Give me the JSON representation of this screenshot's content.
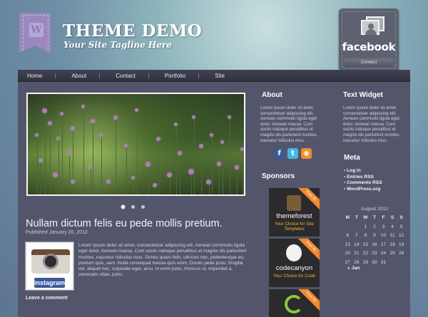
{
  "site": {
    "title": "THEME DEMO",
    "tagline": "Your Site Tagline Here",
    "logo_letter": "W"
  },
  "facebook": {
    "brand": "facebook",
    "connect_label": "Connect"
  },
  "nav": {
    "items": [
      "Home",
      "About",
      "Contact",
      "Portfolio",
      "Site"
    ]
  },
  "slider": {
    "dots": 3,
    "active_dot": 0
  },
  "post": {
    "title": "Nullam dictum felis eu pede mollis pretium.",
    "date": "Published January 20, 2012",
    "thumb_label": "instagram",
    "excerpt": "Lorem ipsum dolor sit amet, consectetuer adipiscing elit. Aenean commodo ligula eget dolor. Aenean massa. Cum sociis natoque penatibus et magnis dis parturient montes, nascetur ridiculus mus. Donec quam felis, ultricies nec, pellentesque eu, pretium quis, sem. Nulla consequat massa quis enim. Donec pede justo, fringilla vel, aliquet nec, vulputate eget, arcu. In enim justo, rhoncus ut, imperdiet a, venenatis vitae, justo.",
    "leave_comment": "Leave a comment"
  },
  "about": {
    "title": "About",
    "text": "Lorem ipsum dolor sit amet, consectetuer adipiscing elit. Aenean commodo ligula eget dolor. Aenean massa. Cum sociis natoque penatibus et magnis dis parturient montes, nascetur ridiculus mus."
  },
  "text_widget": {
    "title": "Text Widget",
    "text": "Lorem ipsum dolor sit amet, consectetuer adipiscing elit. Aenean commodo ligula eget dolor. Aenean massa. Cum sociis natoque penatibus et magnis dis parturient montes, nascetur ridiculus mus."
  },
  "social_icons": [
    "facebook-icon",
    "twitter-icon",
    "rss-icon"
  ],
  "sponsors": {
    "title": "Sponsors",
    "items": [
      {
        "corner": "From $1",
        "brand": "themeforest",
        "sub": "Your Choice for Site Templates"
      },
      {
        "corner": "From $1",
        "brand": "codecanyon",
        "sub": "Your Choice for Code"
      },
      {
        "corner": "From $1",
        "brand": "",
        "sub": ""
      }
    ]
  },
  "meta": {
    "title": "Meta",
    "items": [
      "Log in",
      "Entries RSS",
      "Comments RSS",
      "WordPress.org"
    ]
  },
  "calendar": {
    "caption": "August 2012",
    "headers": [
      "M",
      "T",
      "W",
      "T",
      "F",
      "S",
      "S"
    ],
    "cells": [
      "",
      "",
      "1",
      "2",
      "3",
      "4",
      "5",
      "6",
      "7",
      "8",
      "9",
      "10",
      "11",
      "12",
      "13",
      "14",
      "15",
      "16",
      "17",
      "18",
      "19",
      "20",
      "21",
      "22",
      "23",
      "24",
      "25",
      "26",
      "27",
      "28",
      "29",
      "30",
      "31",
      "",
      ""
    ],
    "prev_link": "« Jan"
  },
  "colors": {
    "panel": "#53566b",
    "navbar": "#3a3c4b",
    "ribbon": "#9a88bf",
    "accent_orange": "#f08a2d"
  }
}
